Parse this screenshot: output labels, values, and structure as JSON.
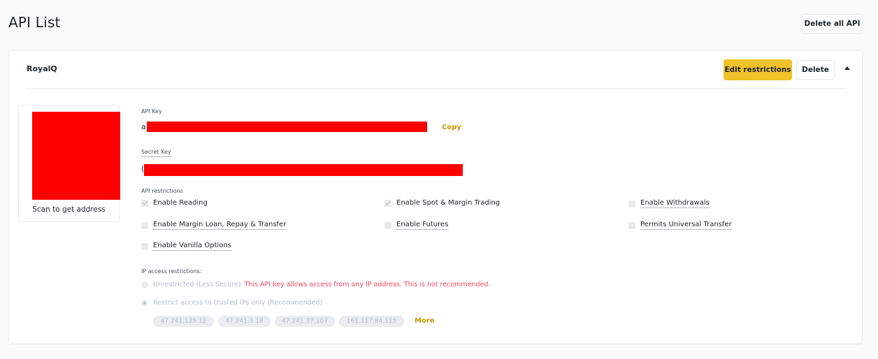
{
  "header": {
    "title": "API List",
    "delete_all_label": "Delete all API"
  },
  "api_card": {
    "name": "RoyalQ",
    "edit_label": "Edit restrictions",
    "delete_label": "Delete",
    "collapse_icon": "caret-up-icon",
    "qr": {
      "label": "Scan to get address",
      "redacted": true
    },
    "api_key": {
      "label": "API Key",
      "visible_prefix": "a",
      "redacted": true,
      "copy_label": "Copy"
    },
    "secret_key": {
      "label": "Secret Key",
      "visible_prefix": "(",
      "redacted": true
    },
    "restrictions": {
      "label": "API restrictions",
      "items": [
        {
          "label": "Enable Reading",
          "checked": true
        },
        {
          "label": "Enable Spot & Margin Trading",
          "checked": true
        },
        {
          "label": "Enable Withdrawals",
          "checked": false
        },
        {
          "label": "Enable Margin Loan, Repay & Transfer",
          "checked": false
        },
        {
          "label": "Enable Futures",
          "checked": false
        },
        {
          "label": "Permits Universal Transfer",
          "checked": false
        },
        {
          "label": "Enable Vanilla Options",
          "checked": false
        }
      ]
    },
    "ip_access": {
      "label": "IP access restrictions:",
      "options": [
        {
          "label": "Unrestricted (Less Secure)",
          "warning": "This API key allows access from any IP address. This is not recommended.",
          "selected": false
        },
        {
          "label": "Restrict access to trusted IPs only (Recommended)",
          "selected": true
        }
      ],
      "ips": [
        "47.241.125.12",
        "47.241.3.18",
        "47.241.37.107",
        "161.117.84.115"
      ],
      "more_label": "More"
    }
  },
  "colors": {
    "accent": "#f0c229",
    "link": "#c99400",
    "warning": "#f6465d",
    "redaction": "#ff0000"
  }
}
